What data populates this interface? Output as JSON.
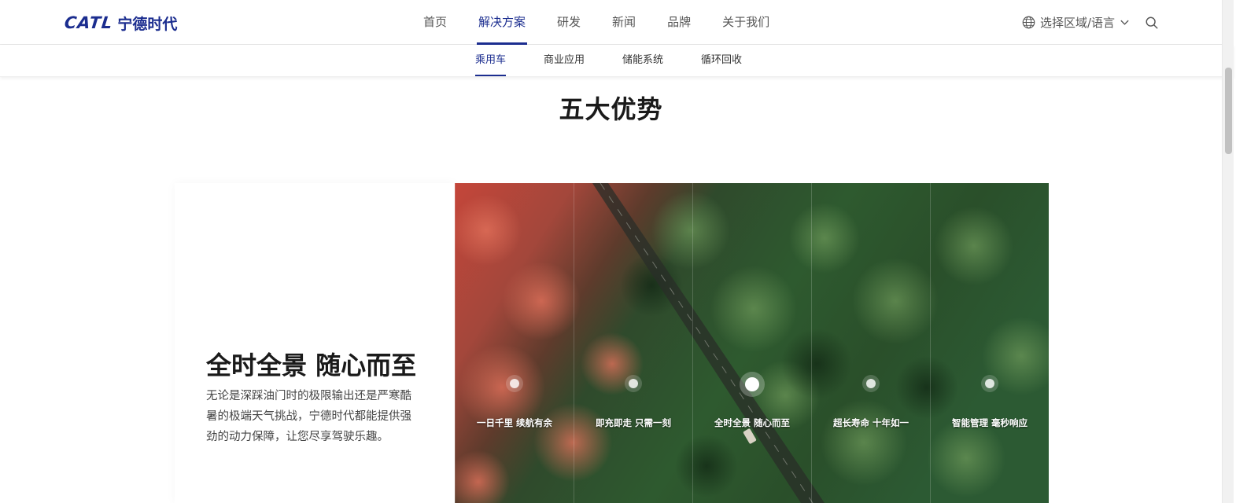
{
  "header": {
    "logo_latin": "CATL",
    "logo_cn": "宁德时代",
    "nav": [
      {
        "label": "首页"
      },
      {
        "label": "解决方案"
      },
      {
        "label": "研发"
      },
      {
        "label": "新闻"
      },
      {
        "label": "品牌"
      },
      {
        "label": "关于我们"
      }
    ],
    "active_nav": "解决方案",
    "region_label": "选择区域/语言"
  },
  "sub_nav": {
    "items": [
      {
        "label": "乘用车"
      },
      {
        "label": "商业应用"
      },
      {
        "label": "储能系统"
      },
      {
        "label": "循环回收"
      }
    ],
    "active": "乘用车"
  },
  "section": {
    "title": "五大优势",
    "heading": "全时全景 随心而至",
    "description": "无论是深踩油门时的极限输出还是严寒酷暑的极端天气挑战，宁德时代都能提供强劲的动力保障，让您尽享驾驶乐趣。"
  },
  "panels": [
    {
      "label": "一日千里 续航有余"
    },
    {
      "label": "即充即走 只需一刻"
    },
    {
      "label": "全时全景 随心而至"
    },
    {
      "label": "超长寿命 十年如一"
    },
    {
      "label": "智能管理 毫秒响应"
    }
  ],
  "active_panel": 2,
  "colors": {
    "brand": "#1b2d8f",
    "text_dark": "#1a1a1a"
  }
}
